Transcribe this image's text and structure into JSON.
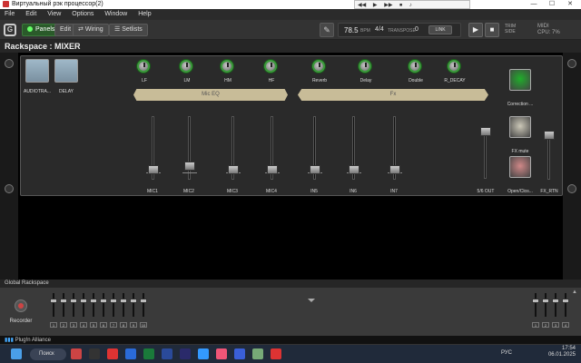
{
  "window": {
    "title": "Виртуальный рэк процессор(2)"
  },
  "media": {
    "items": [
      "◀◀",
      "▶",
      "▶▶",
      "⏹",
      "♪"
    ]
  },
  "menu": [
    "File",
    "Edit",
    "View",
    "Options",
    "Window",
    "Help"
  ],
  "toolbar": {
    "logo": "G",
    "panels": "Panels",
    "edit": "Edit",
    "wiring": "Wiring",
    "setlists": "Setlists",
    "bpm_value": "78.5",
    "bpm_unit": "BPM",
    "time_sig": "4/4",
    "transpose_label": "TRANSPOSE",
    "transpose_value": "0",
    "link": "LINK",
    "trim": "TRIM",
    "side": "SIDE",
    "midi": "MIDI",
    "cpu": "CPU: 7%"
  },
  "rack": {
    "title": "Rackspace : MIXER"
  },
  "panel": {
    "buttons": [
      "AUDIOTRA...",
      "DELAY"
    ],
    "knobs": [
      "LF",
      "LM",
      "HM",
      "HF",
      "Reverb",
      "Delay",
      "Double",
      "R_DECAY"
    ],
    "bars": [
      "Mic EQ",
      "Fx"
    ],
    "faders": [
      "MIC1",
      "MIC2",
      "MIC3",
      "MIC4",
      "IN5",
      "IN6",
      "IN7"
    ],
    "fader_levels": [
      0.08,
      0.14,
      0.08,
      0.08,
      0.08,
      0.08,
      0.08
    ],
    "out_fader": "5/6 OUT",
    "fxrtn_fader": "FX_RTN",
    "side_buttons": [
      "Correction ...",
      "FX mute",
      "Open/Clos..."
    ],
    "side_colors": [
      "#1fae2a",
      "#ccc8b8",
      "#d08888"
    ]
  },
  "global": {
    "title": "Global Rackspace",
    "recorder": "Recorder",
    "left_nums": [
      "1",
      "2",
      "3",
      "4",
      "5",
      "6",
      "7",
      "8",
      "9",
      "10"
    ],
    "right_nums": [
      "1",
      "2",
      "3",
      "4"
    ]
  },
  "plugin": {
    "label": "Plug!n Alliance"
  },
  "taskbar": {
    "search": "Поиск",
    "lang": "РУС",
    "time": "17:54",
    "date": "06.01.2025"
  }
}
